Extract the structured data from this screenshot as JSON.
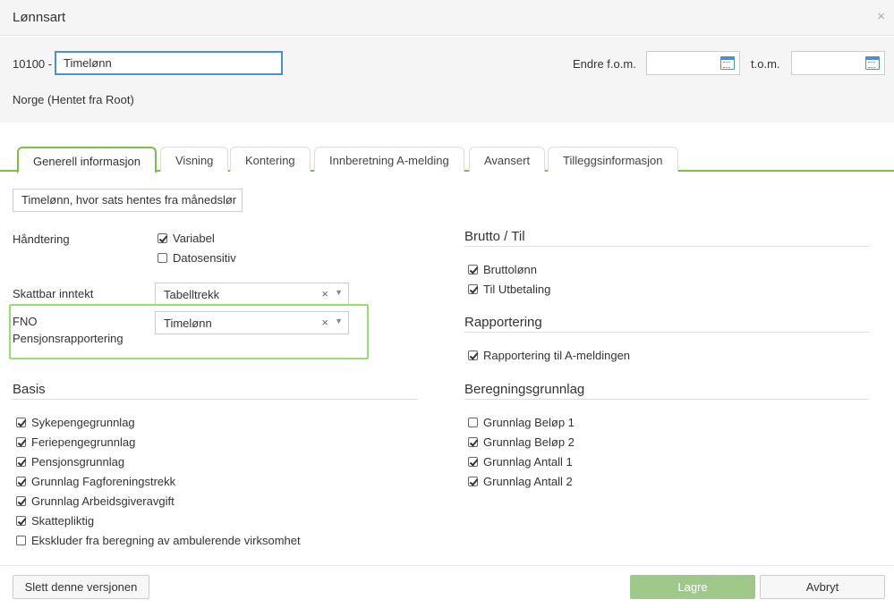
{
  "dialog": {
    "title": "Lønnsart",
    "close_glyph": "×"
  },
  "header": {
    "code": "10100 -",
    "name_value": "Timelønn",
    "fom_label": "Endre f.o.m.",
    "tom_label": "t.o.m.",
    "country": "Norge (Hentet fra Root)"
  },
  "tabs": [
    {
      "label": "Generell informasjon",
      "active": true
    },
    {
      "label": "Visning"
    },
    {
      "label": "Kontering"
    },
    {
      "label": "Innberetning A-melding"
    },
    {
      "label": "Avansert"
    },
    {
      "label": "Tilleggsinformasjon"
    }
  ],
  "general": {
    "description": "Timelønn, hvor sats hentes fra månedslør",
    "handtering_label": "Håndtering",
    "variabel_label": "Variabel",
    "variabel_checked": true,
    "datosensitiv_label": "Datosensitiv",
    "datosensitiv_checked": false,
    "skattbar_label": "Skattbar inntekt",
    "skattbar_value": "Tabelltrekk",
    "fno_label_line1": "FNO",
    "fno_label_line2": "Pensjonsrapportering",
    "fno_value": "Timelønn",
    "clear_glyph": "×",
    "arrow_glyph": "▼"
  },
  "basis": {
    "title": "Basis",
    "items": [
      {
        "label": "Sykepengegrunnlag",
        "checked": true
      },
      {
        "label": "Feriepengegrunnlag",
        "checked": true
      },
      {
        "label": "Pensjonsgrunnlag",
        "checked": true
      },
      {
        "label": "Grunnlag Fagforeningstrekk",
        "checked": true
      },
      {
        "label": "Grunnlag Arbeidsgiveravgift",
        "checked": true
      },
      {
        "label": "Skattepliktig",
        "checked": true
      },
      {
        "label": "Ekskluder fra beregning av ambulerende virksomhet",
        "checked": false
      }
    ]
  },
  "brutto": {
    "title": "Brutto / Til",
    "items": [
      {
        "label": "Bruttolønn",
        "checked": true
      },
      {
        "label": "Til Utbetaling",
        "checked": true
      }
    ]
  },
  "rapportering": {
    "title": "Rapportering",
    "items": [
      {
        "label": "Rapportering til A-meldingen",
        "checked": true
      }
    ]
  },
  "beregning": {
    "title": "Beregningsgrunnlag",
    "items": [
      {
        "label": "Grunnlag Beløp 1",
        "checked": false
      },
      {
        "label": "Grunnlag Beløp 2",
        "checked": true
      },
      {
        "label": "Grunnlag Antall 1",
        "checked": true
      },
      {
        "label": "Grunnlag Antall 2",
        "checked": true
      }
    ]
  },
  "footer": {
    "delete_label": "Slett denne versjonen",
    "save_label": "Lagre",
    "cancel_label": "Avbryt"
  },
  "colors": {
    "accent_green": "#7bbf44",
    "highlight_green": "#9bdc6e",
    "primary_button": "#9fc98a",
    "focus_blue": "#4a90d9"
  }
}
